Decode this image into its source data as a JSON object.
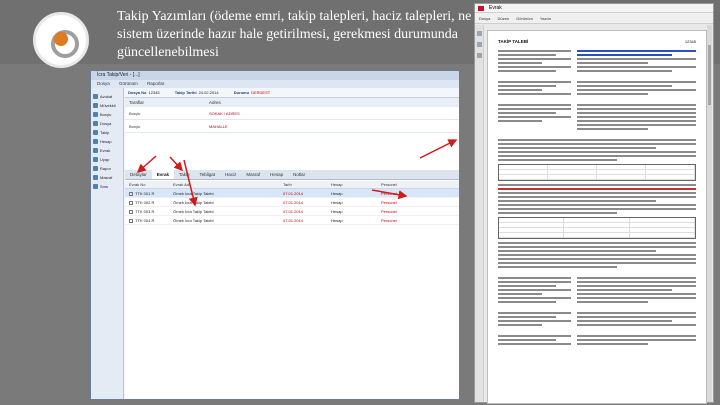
{
  "slide": {
    "title_lines": [
      "Takip Yazımları (ödeme emri, takip talepleri, haciz talepleri, ne",
      "sistem üzerinde hazır hale getirilmesi, gerekmesi durumunda",
      "güncellenebilmesi"
    ],
    "accent_color": "#e07a1f"
  },
  "app": {
    "window_title": "İcra Takip/Veri - [...]",
    "menu": [
      "Dosya",
      "Görünüm",
      "Raporlar"
    ],
    "sidebar": [
      "Avukat",
      "Müvekkil",
      "Borçlu",
      "Dosya",
      "Takip",
      "Hesap",
      "Evrak",
      "Uyap",
      "Rapor",
      "Masraf",
      "Sms"
    ],
    "info": {
      "dosya_label": "Dosya No",
      "dosya": "12345",
      "takip_label": "Takip Tarihi",
      "takip": "24.02.2014",
      "durum_label": "Durumu",
      "durum": "DERDEST"
    },
    "section_headers": [
      "Taraflar",
      "Adres"
    ],
    "parties": [
      {
        "role": "Borçlu",
        "detail": "SOKAK / ADRES"
      },
      {
        "role": "Borçlu",
        "detail": "MAHALLE"
      }
    ],
    "tabs": [
      "Detaylar",
      "Evrak",
      "Takip",
      "Tebligat",
      "Haciz",
      "Masraf",
      "Hesap",
      "Notlar"
    ],
    "grid_header": [
      "Evrak No",
      "Evrak Adı",
      "Tarih",
      "Hesap",
      "Personel"
    ],
    "grid_rows": [
      {
        "no": "TTK 001 R",
        "name": "Örnek İcra Takip Talebi",
        "date": "07.01.2014",
        "hesap": "Hesap",
        "personel": "Personel"
      },
      {
        "no": "TTK 002 R",
        "name": "Örnek İcra Takip Talebi",
        "date": "07.01.2014",
        "hesap": "Hesap",
        "personel": "Personel"
      },
      {
        "no": "TTK 003 R",
        "name": "Örnek İcra Takip Talebi",
        "date": "07.01.2014",
        "hesap": "Hesap",
        "personel": "Personel"
      },
      {
        "no": "TTK 004 R",
        "name": "Örnek İcra Takip Talebi",
        "date": "07.01.2014",
        "hesap": "Hesap",
        "personel": "Personel"
      }
    ]
  },
  "doc": {
    "window_title": "Evrak",
    "toolbar": [
      "Dosya",
      "Düzen",
      "Görünüm",
      "Yazdır"
    ],
    "page_title": "TAKİP TALEBİ",
    "page_id": "12345"
  }
}
